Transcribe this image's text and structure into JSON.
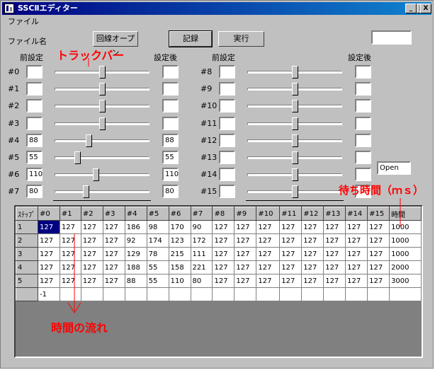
{
  "window": {
    "title": "SSCⅡエディター",
    "minimize": "_",
    "maximize": "□",
    "close": "X"
  },
  "menu": {
    "file": "ファイル"
  },
  "toolbar": {
    "file_label": "ファイル名",
    "open_port_button": "回線オープン",
    "record_button": "記録",
    "run_button": "実行",
    "top_right_value": ""
  },
  "headers": {
    "before_left": "前設定",
    "after_left": "設定後",
    "before_right": "前設定",
    "after_right": "設定後"
  },
  "channels_left": [
    {
      "label": "#0",
      "before": "",
      "after": "",
      "level": 0.5,
      "selected": false
    },
    {
      "label": "#1",
      "before": "",
      "after": "",
      "level": 0.5,
      "selected": false
    },
    {
      "label": "#2",
      "before": "",
      "after": "",
      "level": 0.5,
      "selected": false
    },
    {
      "label": "#3",
      "before": "",
      "after": "",
      "level": 0.5,
      "selected": false
    },
    {
      "label": "#4",
      "before": "88",
      "after": "88",
      "level": 0.35,
      "selected": false
    },
    {
      "label": "#5",
      "before": "55",
      "after": "55",
      "level": 0.22,
      "selected": false
    },
    {
      "label": "#6",
      "before": "110",
      "after": "110",
      "level": 0.43,
      "selected": false
    },
    {
      "label": "#7",
      "before": "80",
      "after": "80",
      "level": 0.32,
      "selected": true
    }
  ],
  "channels_right": [
    {
      "label": "#8",
      "before": "",
      "after": "",
      "level": 0.5,
      "selected": false
    },
    {
      "label": "#9",
      "before": "",
      "after": "",
      "level": 0.5,
      "selected": false
    },
    {
      "label": "#10",
      "before": "",
      "after": "",
      "level": 0.5,
      "selected": false
    },
    {
      "label": "#11",
      "before": "",
      "after": "",
      "level": 0.5,
      "selected": false
    },
    {
      "label": "#12",
      "before": "",
      "after": "",
      "level": 0.5,
      "selected": false
    },
    {
      "label": "#13",
      "before": "",
      "after": "",
      "level": 0.5,
      "selected": false
    },
    {
      "label": "#14",
      "before": "",
      "after": "",
      "level": 0.5,
      "selected": false
    },
    {
      "label": "#15",
      "before": "",
      "after": "",
      "level": 0.5,
      "selected": true
    }
  ],
  "status": {
    "port_state": "Open"
  },
  "annotations": {
    "trackbar": "トラックバー",
    "wait_time": "待ち時間（ｍｓ）",
    "time_flow": "時間の流れ",
    "color": "#ff0000"
  },
  "grid": {
    "columns": [
      "ｽﾃｯﾌﾟ",
      "#0",
      "#1",
      "#2",
      "#3",
      "#4",
      "#5",
      "#6",
      "#7",
      "#8",
      "#9",
      "#10",
      "#11",
      "#12",
      "#13",
      "#14",
      "#15",
      "時間"
    ],
    "rows": [
      [
        "1",
        "127",
        "127",
        "127",
        "127",
        "186",
        "98",
        "170",
        "90",
        "127",
        "127",
        "127",
        "127",
        "127",
        "127",
        "127",
        "127",
        "1000"
      ],
      [
        "2",
        "127",
        "127",
        "127",
        "127",
        "92",
        "174",
        "123",
        "172",
        "127",
        "127",
        "127",
        "127",
        "127",
        "127",
        "127",
        "127",
        "1000"
      ],
      [
        "3",
        "127",
        "127",
        "127",
        "127",
        "129",
        "78",
        "215",
        "111",
        "127",
        "127",
        "127",
        "127",
        "127",
        "127",
        "127",
        "127",
        "1000"
      ],
      [
        "4",
        "127",
        "127",
        "127",
        "127",
        "188",
        "55",
        "158",
        "221",
        "127",
        "127",
        "127",
        "127",
        "127",
        "127",
        "127",
        "127",
        "2000"
      ],
      [
        "5",
        "127",
        "127",
        "127",
        "127",
        "88",
        "55",
        "110",
        "80",
        "127",
        "127",
        "127",
        "127",
        "127",
        "127",
        "127",
        "127",
        "3000"
      ],
      [
        "",
        "-1",
        "",
        "",
        "",
        "",
        "",
        "",
        "",
        "",
        "",
        "",
        "",
        "",
        "",
        "",
        "",
        ""
      ]
    ]
  }
}
